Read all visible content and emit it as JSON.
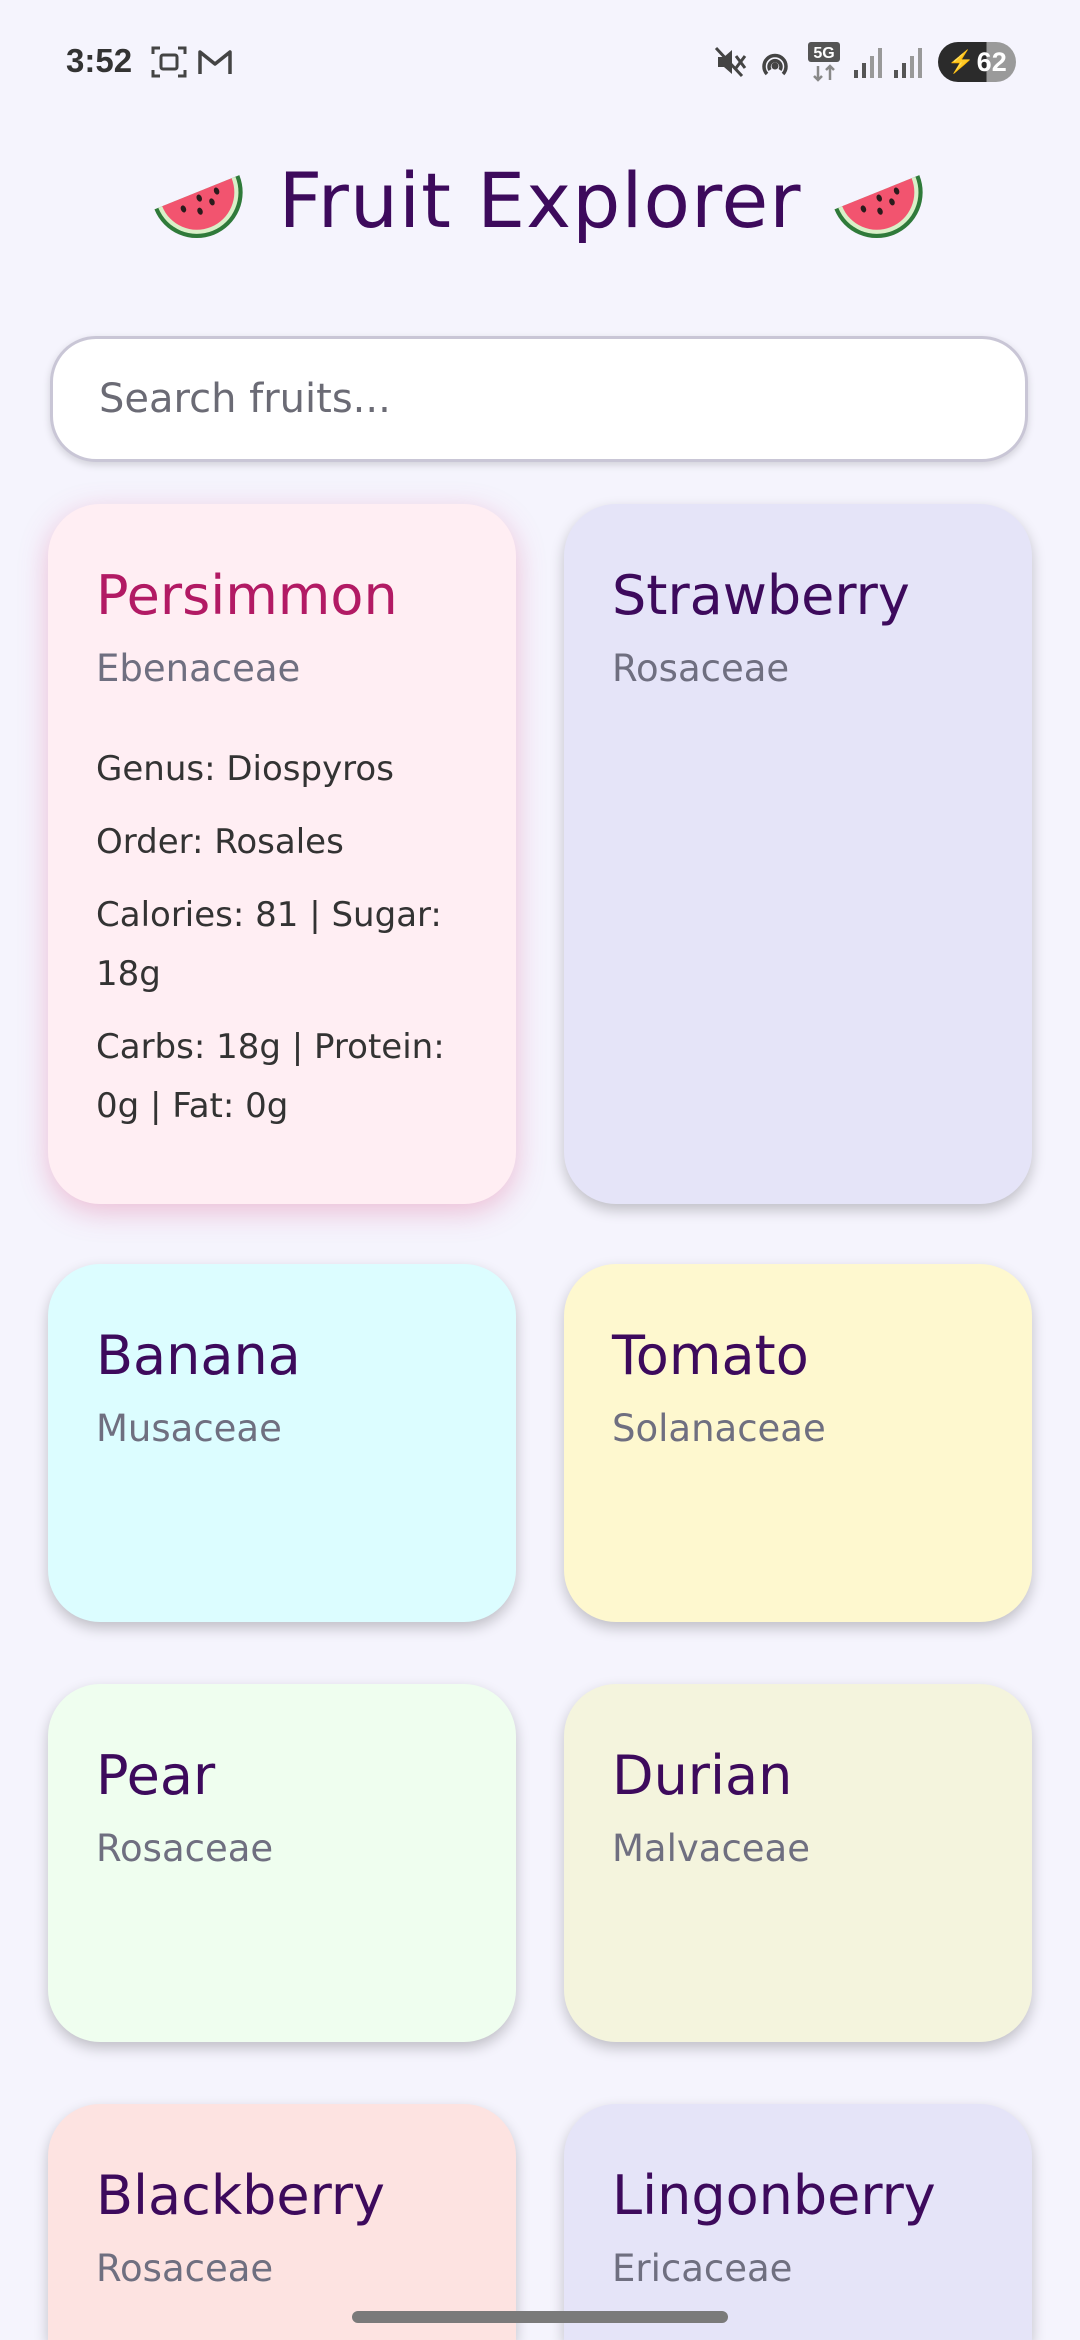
{
  "status_bar": {
    "time": "3:52",
    "battery": "62",
    "network": "5G"
  },
  "header": {
    "title": "Fruit Explorer",
    "left_icon": "watermelon-icon",
    "right_icon": "watermelon-icon"
  },
  "search": {
    "placeholder": "Search fruits...",
    "value": ""
  },
  "cards": [
    {
      "name": "Persimmon",
      "family": "Ebenaceae",
      "background": "#ffeef3",
      "expanded": true,
      "details": {
        "genus": "Genus: Diospyros",
        "order": "Order: Rosales",
        "calories_sugar": "Calories: 81 | Sugar: 18g",
        "macros": "Carbs: 18g | Protein: 0g | Fat: 0g"
      }
    },
    {
      "name": "Strawberry",
      "family": "Rosaceae",
      "background": "#e5e4f8"
    },
    {
      "name": "Banana",
      "family": "Musaceae",
      "background": "#dcfdff"
    },
    {
      "name": "Tomato",
      "family": "Solanaceae",
      "background": "#fef8cf"
    },
    {
      "name": "Pear",
      "family": "Rosaceae",
      "background": "#effeef"
    },
    {
      "name": "Durian",
      "family": "Malvaceae",
      "background": "#f4f4dd"
    },
    {
      "name": "Blackberry",
      "family": "Rosaceae",
      "background": "#fde3e1"
    },
    {
      "name": "Lingonberry",
      "family": "Ericaceae",
      "background": "#e5e4f8"
    }
  ],
  "colors": {
    "page_background": "#f5f4fd",
    "title": "#3d0a5c",
    "selected_name": "#b21a64",
    "family_text": "#6f6f80"
  }
}
